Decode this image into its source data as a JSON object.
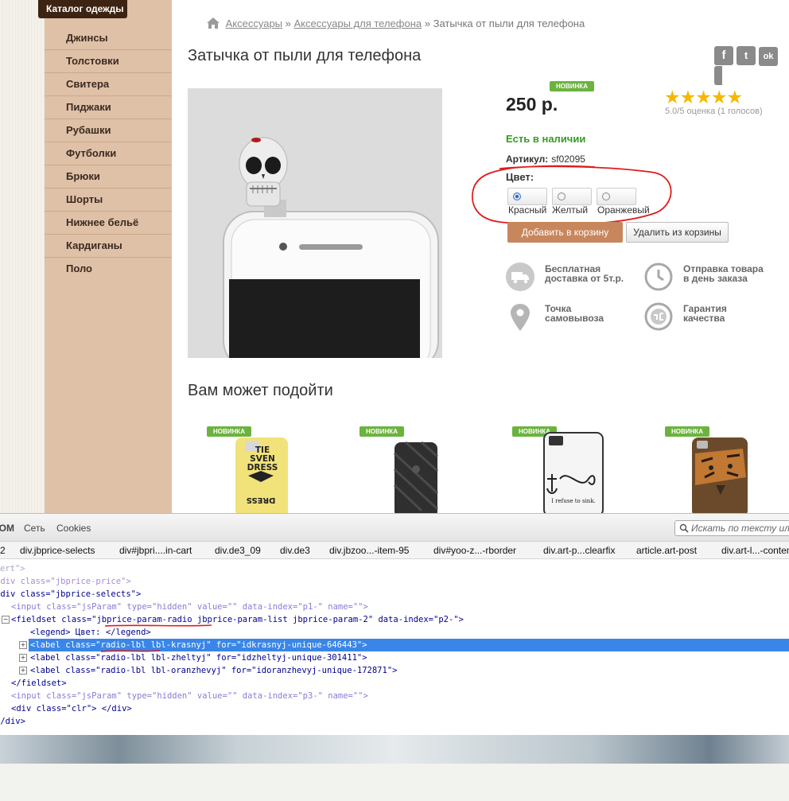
{
  "sidebar": {
    "heading": "Каталог одежды",
    "items": [
      "Джинсы",
      "Толстовки",
      "Свитера",
      "Пиджаки",
      "Рубашки",
      "Футболки",
      "Брюки",
      "Шорты",
      "Нижнее бельё",
      "Кардиганы",
      "Поло"
    ]
  },
  "breadcrumb": {
    "item1": "Аксессуары",
    "sep1": "»",
    "item2": "Аксессуары для телефона",
    "sep2": "»",
    "current": "Затычка от пыли для телефона"
  },
  "product": {
    "title": "Затычка от пыли для телефона",
    "badge": "НОВИНКА",
    "price": "250 р.",
    "stars": "★★★★★",
    "rating_text": "5.0/5 оценка (1 голосов)",
    "stock": "Есть в наличии",
    "sku_label": "Артикул:",
    "sku_value": "sf02095",
    "color_label": "Цвет:",
    "colors": [
      "Красный",
      "Желтый",
      "Оранжевый"
    ],
    "selected_color": "Красный",
    "add_button": "Добавить в корзину",
    "remove_button": "Удалить из корзины"
  },
  "social": [
    "f",
    "t",
    "ok"
  ],
  "features": [
    {
      "icon": "truck-icon",
      "text": "Бесплатная доставка от 5т.р."
    },
    {
      "icon": "clock-icon",
      "text": "Отправка товара в день заказа"
    },
    {
      "icon": "map-pin-icon",
      "text": "Точка самовывоза"
    },
    {
      "icon": "quality-seal-icon",
      "text": "Гарантия качества"
    }
  ],
  "recommend": {
    "title": "Вам может подойти",
    "badge": "НОВИНКА",
    "case1_text": "TIE\nSVEN\nDRESS",
    "case1_bottom": "DRESS",
    "case3_text": "I refuse to sink."
  },
  "devtools": {
    "tabs": [
      "DOM",
      "Сеть",
      "Cookies"
    ],
    "search_placeholder": "Искать по тексту или",
    "crumbs": [
      "2",
      "div.jbprice-selects",
      "div#jbpri....in-cart",
      "div.de3_09",
      "div.de3",
      "div.jbzoo...-item-95",
      "div#yoo-z...-rborder",
      "div.art-p...clearfix",
      "article.art-post",
      "div.art-l...-content"
    ],
    "lines": [
      "ert\">",
      "<div class=\"jbprice-price\">",
      "<div class=\"jbprice-selects\">",
      "<input class=\"jsParam\" type=\"hidden\" value=\"\" data-index=\"p1-\" name=\"\">",
      "<fieldset class=\"jbprice-param-radio jbprice-param-list jbprice-param-2\" data-index=\"p2-\">",
      "<legend> Цвет: </legend>",
      "<label class=\"radio-lbl lbl-krasnyj\" for=\"idkrasnyj-unique-646443\">",
      "<label class=\"radio-lbl lbl-zheltyj\" for=\"idzheltyj-unique-301411\">",
      "<label class=\"radio-lbl lbl-oranzhevyj\" for=\"idoranzhevyj-unique-172871\">",
      "</fieldset>",
      "<input class=\"jsParam\" type=\"hidden\" value=\"\" data-index=\"p3-\" name=\"\">",
      "<div class=\"clr\"> </div>",
      "</div>"
    ]
  },
  "colors": {
    "accent_green": "#6bb33e",
    "sidebar_bg": "#dfc1a7",
    "add_button": "#c8865d",
    "annotation_red": "#e11b1b",
    "selection_blue": "#3a86e8"
  }
}
